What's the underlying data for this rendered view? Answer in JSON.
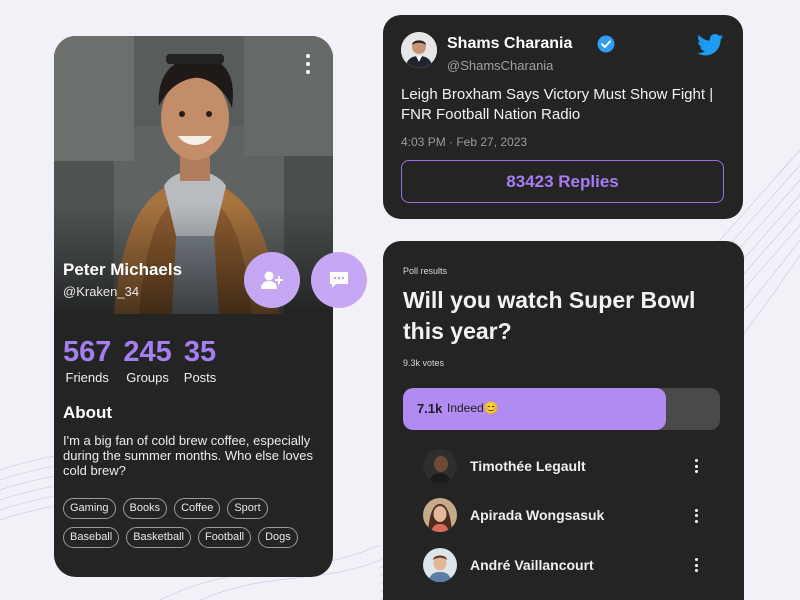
{
  "profile": {
    "name": "Peter Michaels",
    "handle": "@Kraken_34",
    "photo_icon": "profile-photo",
    "stats": [
      {
        "value": "567",
        "label": "Friends"
      },
      {
        "value": "245",
        "label": "Groups"
      },
      {
        "value": "35",
        "label": "Posts"
      }
    ],
    "about_title": "About",
    "about_text": "I'm a big fan of cold brew coffee, especially during the summer months. Who else loves cold brew?",
    "tags": [
      "Gaming",
      "Books",
      "Coffee",
      "Sport",
      "Baseball",
      "Basketball",
      "Football",
      "Dogs"
    ],
    "actions": {
      "add_friend_icon": "add-user-icon",
      "message_icon": "message-icon"
    },
    "accent_color": "#a57ef0"
  },
  "tweet": {
    "author_name": "Shams Charania",
    "author_handle": "@ShamsCharania",
    "verified_icon": "verified-badge-icon",
    "platform_icon": "twitter-icon",
    "text": "Leigh Broxham Says Victory Must Show Fight | FNR Football Nation Radio",
    "timestamp": "4:03 PM · Feb 27, 2023",
    "replies_label": "83423 Replies"
  },
  "poll": {
    "eyebrow": "Poll results",
    "question": "Will you watch Super Bowl this year?",
    "votes": "9.3k votes",
    "option": {
      "count": "7.1k",
      "label": "Indeed😊",
      "fraction": 0.83
    },
    "voters": [
      {
        "name": "Timothée Legault"
      },
      {
        "name": "Apirada Wongsasuk"
      },
      {
        "name": "André Vaillancourt"
      }
    ]
  }
}
